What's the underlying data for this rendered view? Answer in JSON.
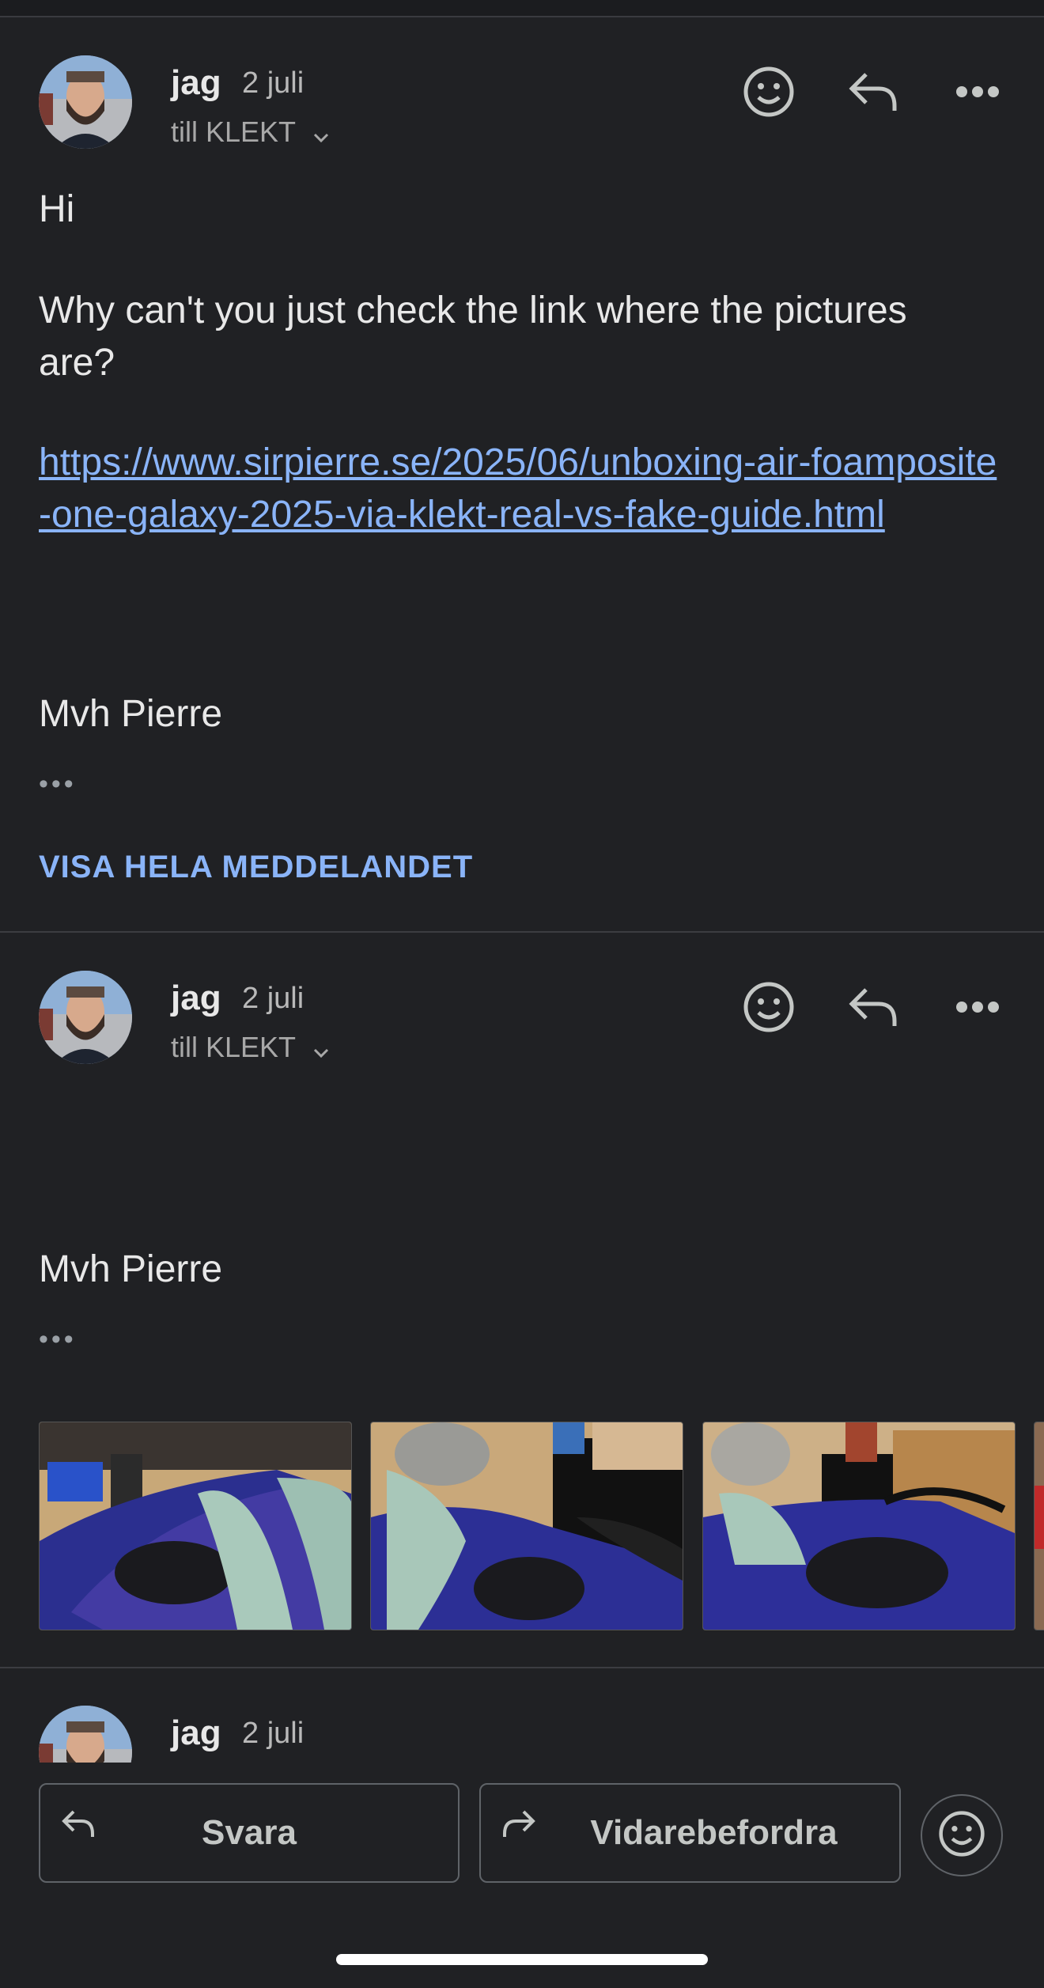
{
  "messages": [
    {
      "sender": "jag",
      "date": "2 juli",
      "to": "till KLEKT",
      "greeting": "Hi",
      "body": "Why can't you just check the link where the pictures are?",
      "link": "https://www.sirpierre.se/2025/06/unboxing-air-foamposite-one-galaxy-2025-via-klekt-real-vs-fake-guide.html",
      "signature": "Mvh Pierre",
      "ellipsis": "•••",
      "show_full": "VISA HELA MEDDELANDET"
    },
    {
      "sender": "jag",
      "date": "2 juli",
      "to": "till KLEKT",
      "signature": "Mvh Pierre",
      "ellipsis": "•••",
      "attachments": [
        "shoe-photo-1",
        "shoe-photo-2",
        "shoe-photo-3"
      ]
    },
    {
      "sender": "jag",
      "date": "2 juli"
    }
  ],
  "actions": {
    "reply": "Svara",
    "forward": "Vidarebefordra"
  },
  "icons": [
    "emoji-icon",
    "reply-icon",
    "more-icon",
    "chevron-down-icon",
    "forward-icon"
  ],
  "colors": {
    "background": "#202124",
    "link": "#8ab4f8",
    "text": "#e3e3e3"
  }
}
